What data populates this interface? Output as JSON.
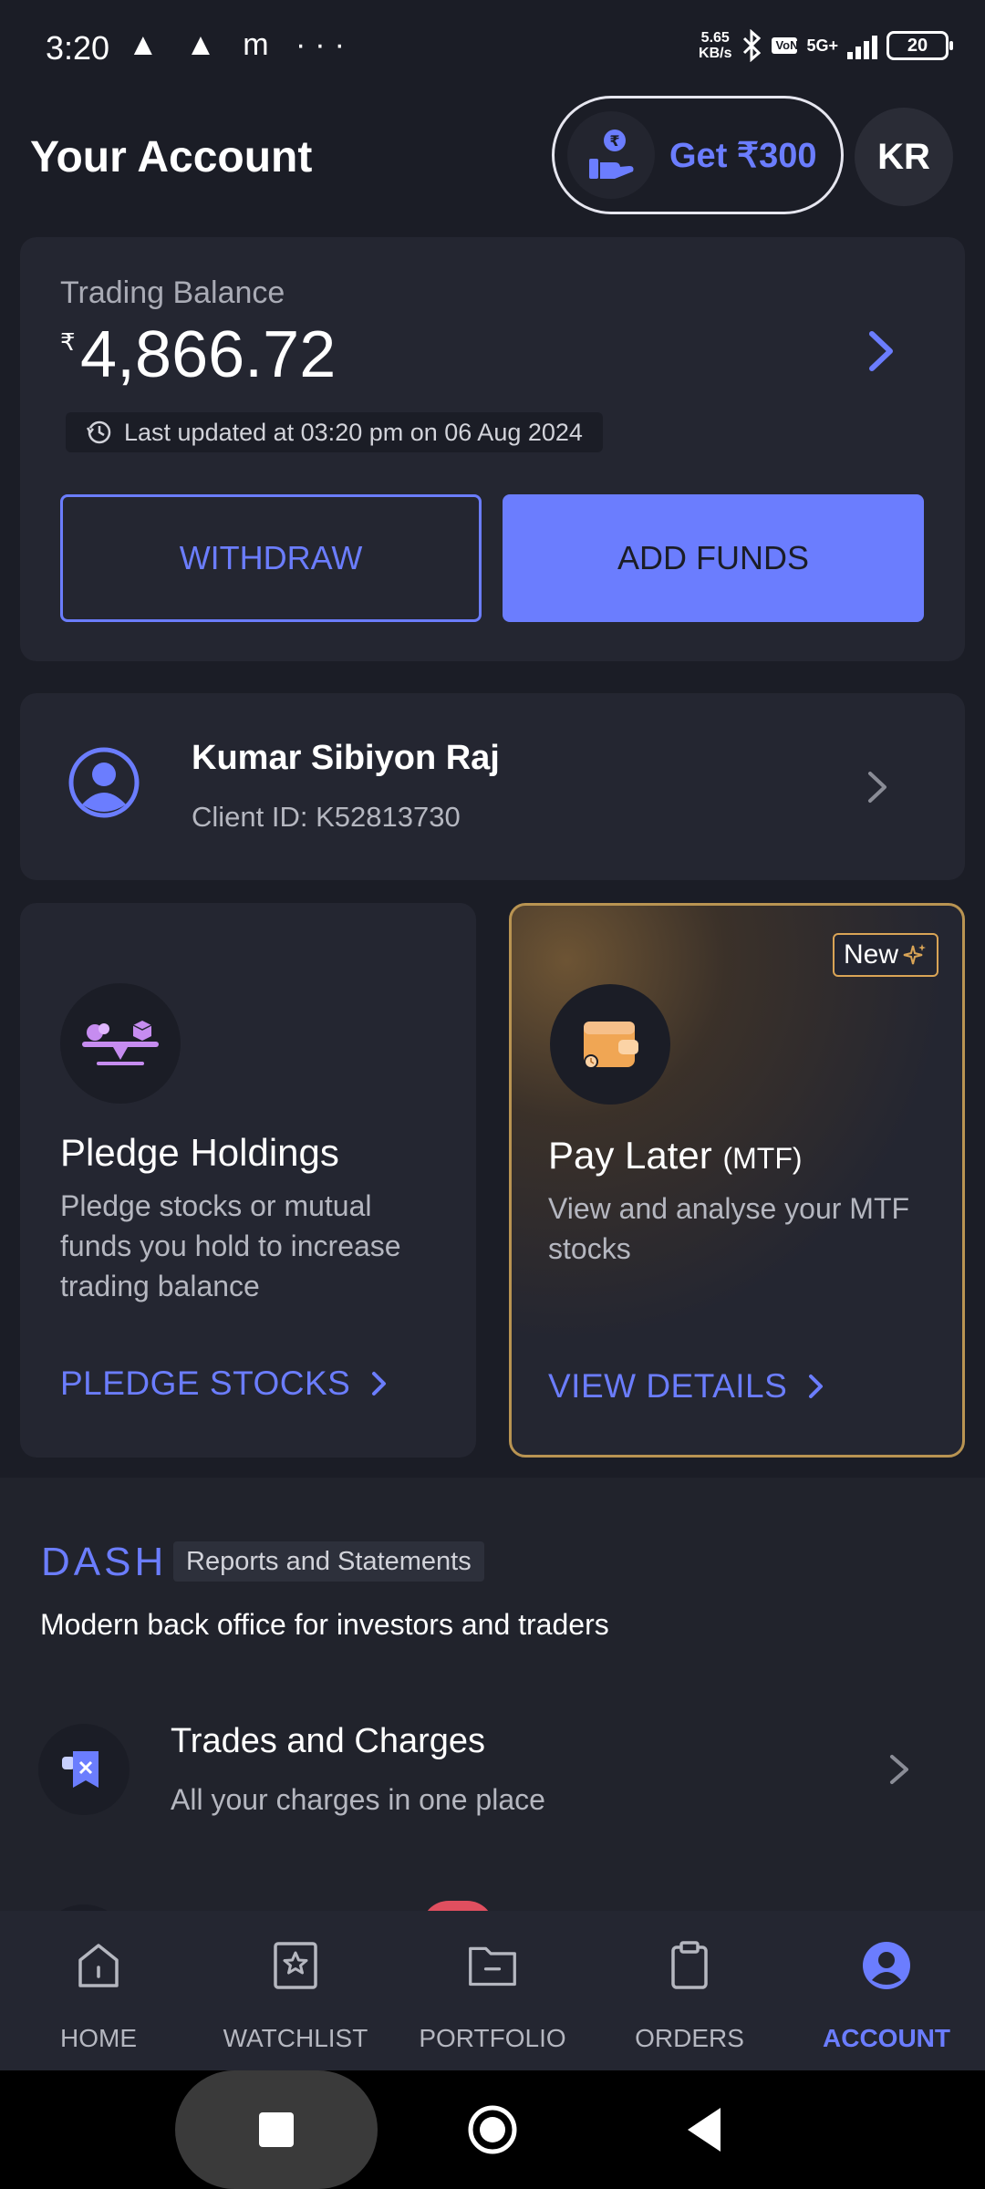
{
  "status_bar": {
    "time": "3:20",
    "left_icons": "▲ ▲ m ···",
    "net_speed_value": "5.65",
    "net_speed_unit": "KB/s",
    "volte": "Vo\nNR",
    "network": "5G+",
    "battery": "20"
  },
  "header": {
    "title": "Your Account",
    "referral_label": "Get ₹300",
    "avatar_initials": "KR"
  },
  "balance": {
    "label": "Trading Balance",
    "currency_symbol": "₹",
    "amount": "4,866.72",
    "last_updated": "Last updated at 03:20 pm on 06 Aug 2024",
    "withdraw_label": "WITHDRAW",
    "add_funds_label": "ADD FUNDS"
  },
  "profile": {
    "name": "Kumar Sibiyon Raj",
    "client_id": "Client ID: K52813730"
  },
  "pledge": {
    "title": "Pledge Holdings",
    "description": "Pledge stocks or mutual funds you hold to increase trading balance",
    "link_label": "PLEDGE STOCKS"
  },
  "pay_later": {
    "badge": "New",
    "title": "Pay Later",
    "title_suffix": "(MTF)",
    "description": "View and analyse your MTF stocks",
    "link_label": "VIEW DETAILS"
  },
  "dash": {
    "logo": "DASH",
    "tag": "Reports and Statements",
    "subtitle": "Modern back office for investors and traders",
    "items": [
      {
        "title": "Trades and Charges",
        "subtitle": "All your charges in one place"
      }
    ]
  },
  "bottom_nav": {
    "items": [
      {
        "label": "HOME",
        "icon": "home-icon"
      },
      {
        "label": "WATCHLIST",
        "icon": "watchlist-icon"
      },
      {
        "label": "PORTFOLIO",
        "icon": "portfolio-icon"
      },
      {
        "label": "ORDERS",
        "icon": "orders-icon"
      },
      {
        "label": "ACCOUNT",
        "icon": "account-icon"
      }
    ],
    "active": "ACCOUNT"
  },
  "colors": {
    "accent": "#6b7dfe",
    "background": "#1b1d26",
    "card": "#242631",
    "gold_border": "#b99452"
  }
}
